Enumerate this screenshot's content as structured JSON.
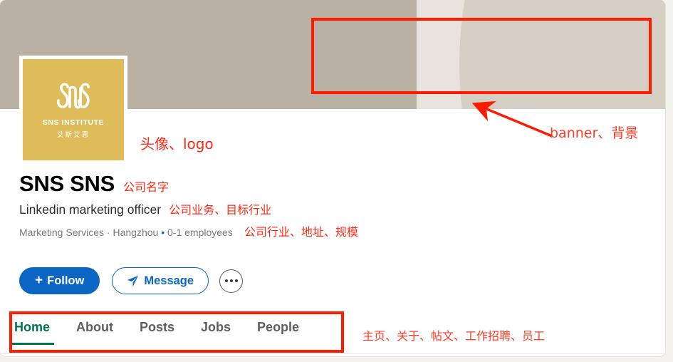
{
  "banner": {
    "name": "company-banner",
    "colors": {
      "left_band": "#b9b1a3",
      "light_strip": "#e8e4dd",
      "right_curve": "#d6cfc5"
    }
  },
  "logo": {
    "brand_text": "SNS INSTITUTE",
    "brand_text_cn": "艾斯艾恩",
    "background_color": "#ddbc59",
    "mark": "sns-monogram"
  },
  "profile": {
    "company_name": "SNS SNS",
    "tagline": "Linkedin marketing officer",
    "industry": "Marketing Services",
    "separator1": " · ",
    "location": "Hangzhou",
    "bullet": " • ",
    "employees": "0-1 employees",
    "meta_line": "Marketing Services · Hangzhou • 0-1 employees"
  },
  "actions": {
    "follow_label": "Follow",
    "follow_plus": "+",
    "message_label": "Message",
    "more_label": "More actions",
    "accent_color": "#0a66c2"
  },
  "tabs": {
    "active": "Home",
    "items": [
      {
        "label": "Home",
        "active": true
      },
      {
        "label": "About",
        "active": false
      },
      {
        "label": "Posts",
        "active": false
      },
      {
        "label": "Jobs",
        "active": false
      },
      {
        "label": "People",
        "active": false
      }
    ],
    "active_color": "#01754f"
  },
  "annotations": {
    "color": "#ff2a16",
    "logo": "头像、logo",
    "banner": "banner、背景",
    "company_name": "公司名字",
    "tagline": "公司业务、目标行业",
    "meta": "公司行业、地址、规模",
    "tabs": "主页、关于、帖文、工作招聘、员工"
  }
}
